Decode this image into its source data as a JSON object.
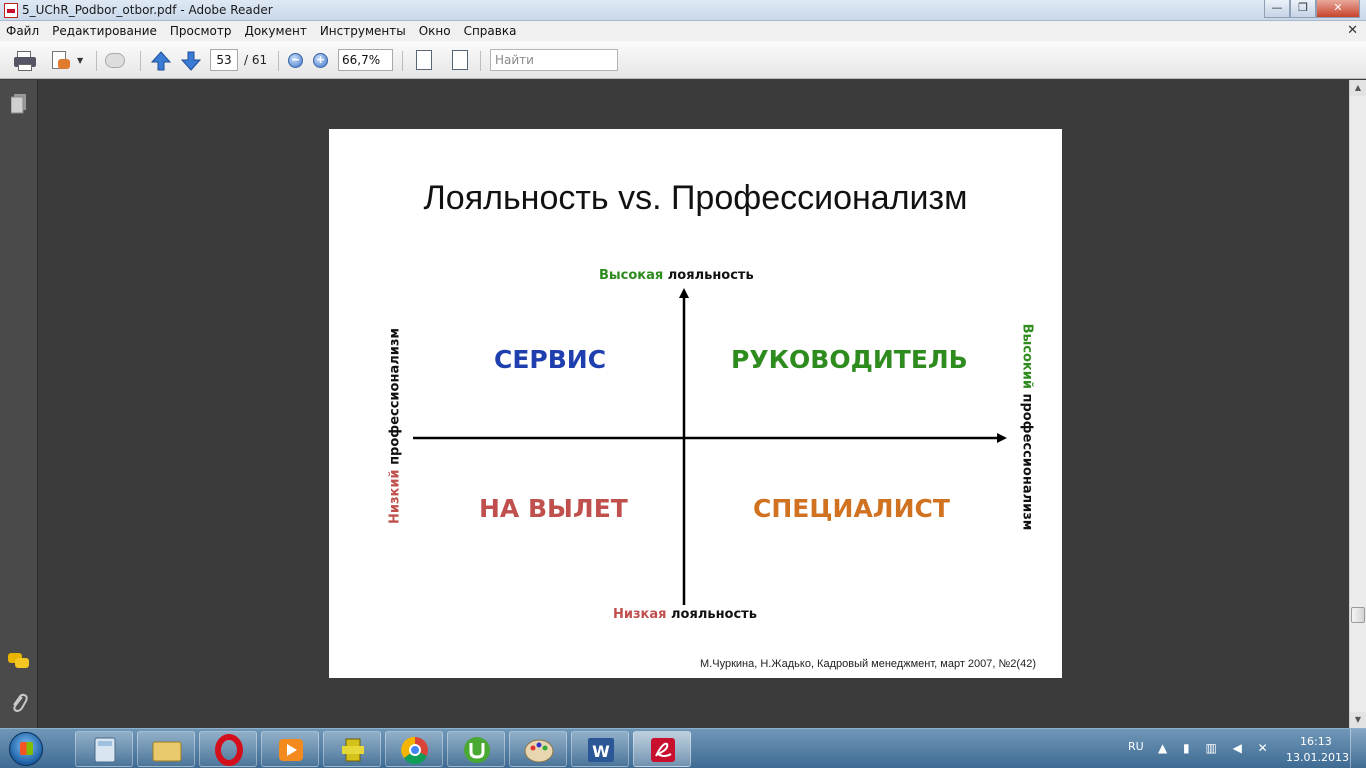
{
  "window": {
    "title": "5_UChR_Podbor_otbor.pdf - Adobe Reader"
  },
  "menu": [
    "Файл",
    "Редактирование",
    "Просмотр",
    "Документ",
    "Инструменты",
    "Окно",
    "Справка"
  ],
  "toolbar": {
    "page_current": "53",
    "page_total": "/ 61",
    "zoom": "66,7%",
    "search_placeholder": "Найти"
  },
  "slide": {
    "title": "Лояльность vs. Профессионализм",
    "top_label_colored": "Высокая",
    "top_label_rest": " лояльность",
    "bottom_label_colored": "Низкая",
    "bottom_label_rest": " лояльность",
    "left_label_colored": "Низкий",
    "left_label_rest": " профессионализм",
    "right_label_colored": "Высокий",
    "right_label_rest": " профессионализм",
    "quadrants": {
      "top_left": "СЕРВИС",
      "top_right": "РУКОВОДИТЕЛЬ",
      "bottom_left": "НА ВЫЛЕТ",
      "bottom_right": "СПЕЦИАЛИСТ"
    },
    "citation": "М.Чуркина, Н.Жадько, Кадровый менеджмент, март 2007, №2(42)"
  },
  "colors": {
    "service": "#1f3fae",
    "leader": "#2e8b1e",
    "out": "#c0504d",
    "specialist": "#d07220"
  },
  "taskbar": {
    "apps": [
      "calculator-icon",
      "file-manager-icon",
      "opera-icon",
      "media-player-icon",
      "game-icon",
      "chrome-icon",
      "utorrent-icon",
      "paint-icon",
      "word-icon",
      "adobe-reader-icon"
    ],
    "language": "RU",
    "time": "16:13",
    "date": "13.01.2013"
  }
}
